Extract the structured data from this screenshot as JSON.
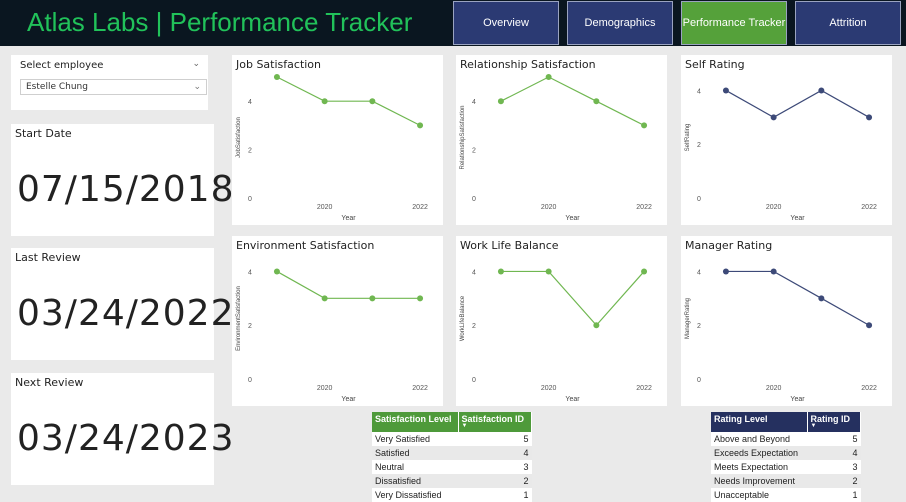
{
  "header": {
    "title": "Atlas Labs | Performance Tracker",
    "nav": [
      {
        "label": "Overview",
        "active": false
      },
      {
        "label": "Demographics",
        "active": false
      },
      {
        "label": "Performance Tracker",
        "active": true
      },
      {
        "label": "Attrition",
        "active": false
      }
    ]
  },
  "slicer": {
    "label": "Select employee",
    "value": "Estelle Chung"
  },
  "dates": [
    {
      "label": "Start Date",
      "value": "07/15/2018"
    },
    {
      "label": "Last Review",
      "value": "03/24/2022"
    },
    {
      "label": "Next Review",
      "value": "03/24/2023"
    }
  ],
  "colors": {
    "green_series": "#70b751",
    "navy_series": "#3d4a78",
    "header_bg": "#0a1620",
    "title_green": "#21c25a",
    "nav_inactive": "#2b3a73",
    "nav_active": "#55a13a",
    "table_green": "#4e9a3a",
    "table_navy": "#25305f"
  },
  "chart_data": [
    {
      "type": "line",
      "title": "Job Satisfaction",
      "ylabel": "JobSatisfaction",
      "xlabel": "Year",
      "x": [
        2019,
        2020,
        2021,
        2022
      ],
      "values": [
        5,
        4,
        4,
        3
      ],
      "ylim": [
        0,
        5
      ],
      "yticks": [
        0,
        2,
        4
      ],
      "xticks": [
        2020,
        2022
      ],
      "color": "green"
    },
    {
      "type": "line",
      "title": "Relationship Satisfaction",
      "ylabel": "RelationshipSatisfaction",
      "xlabel": "Year",
      "x": [
        2019,
        2020,
        2021,
        2022
      ],
      "values": [
        4,
        5,
        4,
        3
      ],
      "ylim": [
        0,
        5
      ],
      "yticks": [
        0,
        2,
        4
      ],
      "xticks": [
        2020,
        2022
      ],
      "color": "green"
    },
    {
      "type": "line",
      "title": "Self Rating",
      "ylabel": "SelfRating",
      "xlabel": "Year",
      "x": [
        2019,
        2020,
        2021,
        2022
      ],
      "values": [
        4,
        3,
        4,
        3
      ],
      "ylim": [
        0,
        4.5
      ],
      "yticks": [
        0,
        2,
        4
      ],
      "xticks": [
        2020,
        2022
      ],
      "color": "navy"
    },
    {
      "type": "line",
      "title": "Environment Satisfaction",
      "ylabel": "EnvironmentSatisfaction",
      "xlabel": "Year",
      "x": [
        2019,
        2020,
        2021,
        2022
      ],
      "values": [
        4,
        3,
        3,
        3
      ],
      "ylim": [
        0,
        4.5
      ],
      "yticks": [
        0,
        2,
        4
      ],
      "xticks": [
        2020,
        2022
      ],
      "color": "green"
    },
    {
      "type": "line",
      "title": "Work Life Balance",
      "ylabel": "WorkLifeBalance",
      "xlabel": "Year",
      "x": [
        2019,
        2020,
        2021,
        2022
      ],
      "values": [
        4,
        4,
        2,
        4
      ],
      "ylim": [
        0,
        4.5
      ],
      "yticks": [
        0,
        2,
        4
      ],
      "xticks": [
        2020,
        2022
      ],
      "color": "green"
    },
    {
      "type": "line",
      "title": "Manager Rating",
      "ylabel": "ManagerRating",
      "xlabel": "Year",
      "x": [
        2019,
        2020,
        2021,
        2022
      ],
      "values": [
        4,
        4,
        3,
        2
      ],
      "ylim": [
        0,
        4.5
      ],
      "yticks": [
        0,
        2,
        4
      ],
      "xticks": [
        2020,
        2022
      ],
      "color": "navy"
    }
  ],
  "tables": {
    "satisfaction": {
      "headers": [
        "Satisfaction Level",
        "Satisfaction ID"
      ],
      "rows": [
        [
          "Very Satisfied",
          "5"
        ],
        [
          "Satisfied",
          "4"
        ],
        [
          "Neutral",
          "3"
        ],
        [
          "Dissatisfied",
          "2"
        ],
        [
          "Very Dissatisfied",
          "1"
        ]
      ]
    },
    "rating": {
      "headers": [
        "Rating Level",
        "Rating ID"
      ],
      "rows": [
        [
          "Above and Beyond",
          "5"
        ],
        [
          "Exceeds Expectation",
          "4"
        ],
        [
          "Meets Expectation",
          "3"
        ],
        [
          "Needs Improvement",
          "2"
        ],
        [
          "Unacceptable",
          "1"
        ]
      ]
    }
  }
}
